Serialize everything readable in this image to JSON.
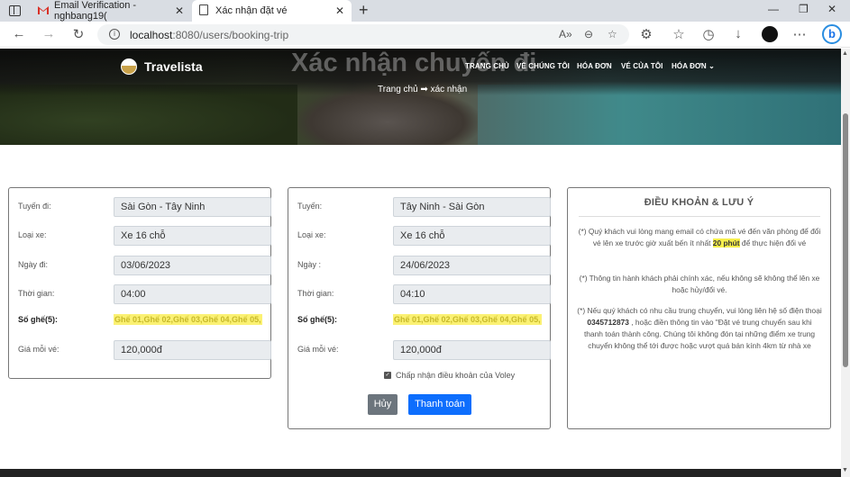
{
  "browser": {
    "tabs": [
      {
        "title": "Email Verification - nghbang19("
      },
      {
        "title": "Xác nhận đặt vé"
      }
    ],
    "address": {
      "host": "localhost",
      "path": ":8080/users/booking-trip"
    }
  },
  "site": {
    "brand": "Travelista",
    "nav": [
      "TRANG CHỦ",
      "VỀ CHÚNG TÔI",
      "HÓA ĐƠN",
      "VÉ CỦA TÔI",
      "HÓA ĐƠN"
    ],
    "page_title": "Xác nhận chuyến đi",
    "breadcrumb": "Trang chủ ➡ xác nhận"
  },
  "outbound": {
    "route_label": "Tuyến đi:",
    "route": "Sài Gòn - Tây Ninh",
    "vehicle_label": "Loại xe:",
    "vehicle": "Xe 16 chỗ",
    "date_label": "Ngày đi:",
    "date": "03/06/2023",
    "time_label": "Thời gian:",
    "time": "04:00",
    "seats_label": "Số ghế(5):",
    "seats": "Ghế 01,Ghế 02,Ghế 03,Ghế 04,Ghế 05,",
    "price_label": "Giá mỗi vé:",
    "price": "120,000đ"
  },
  "return": {
    "route_label": "Tuyến:",
    "route": "Tây Ninh - Sài Gòn",
    "vehicle_label": "Loại xe:",
    "vehicle": "Xe 16 chỗ",
    "date_label": "Ngày :",
    "date": "24/06/2023",
    "time_label": "Thời gian:",
    "time": "04:10",
    "seats_label": "Số ghế(5):",
    "seats": "Ghế 01,Ghế 02,Ghế 03,Ghế 04,Ghế 05,",
    "price_label": "Giá mỗi vé:",
    "price": "120,000đ",
    "terms_checkbox": "Chấp nhận điều khoản của Voley",
    "cancel_label": "Hủy",
    "pay_label": "Thanh toán"
  },
  "terms": {
    "title": "ĐIỀU KHOẢN & LƯU Ý",
    "p1_a": "(*) Quý khách vui lòng mang email có chứa mã vé đến văn phòng để đổi vé lên xe trước giờ xuất bến ít nhất",
    "p1_hl": "20 phút",
    "p1_b": "để thực hiện đổi vé",
    "p2": "(*) Thông tin hành khách phải chính xác, nếu không sẽ không thể lên xe hoặc hủy/đổi vé.",
    "p3_a": "(*) Nếu quý khách có nhu cầu trung chuyển, vui lòng liên hệ số điện thoại",
    "p3_phone": "0345712873",
    "p3_b": ", hoặc điền thông tin vào \"Đặt vé trung chuyển sau khi thanh toán thành công. Chúng tôi không đón tại những điểm xe trung chuyển không thể tới được hoặc vượt quá bán kính 4km từ nhà xe"
  }
}
